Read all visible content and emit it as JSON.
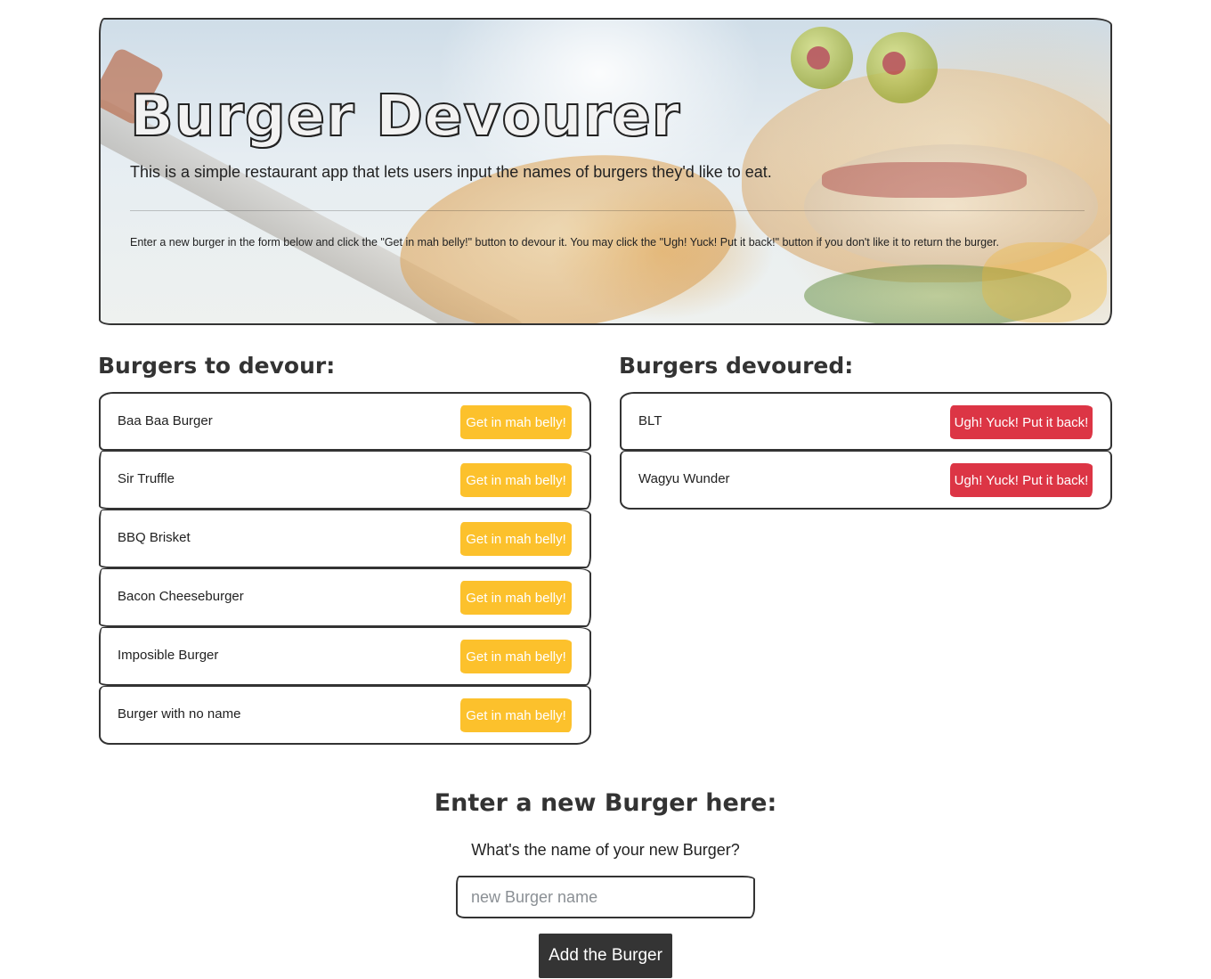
{
  "hero": {
    "title": "Burger Devourer",
    "lead": "This is a simple restaurant app that lets users input the names of burgers they'd like to eat.",
    "instructions": "Enter a new burger in the form below and click the \"Get in mah belly!\" button to devour it. You may click the \"Ugh! Yuck! Put it back!\" button if you don't like it to return the burger."
  },
  "to_devour": {
    "heading": "Burgers to devour:",
    "button_label": "Get in mah belly!",
    "items": [
      {
        "name": "Baa Baa Burger"
      },
      {
        "name": "Sir Truffle"
      },
      {
        "name": "BBQ Brisket"
      },
      {
        "name": "Bacon Cheeseburger"
      },
      {
        "name": "Imposible Burger"
      },
      {
        "name": "Burger with no name"
      }
    ]
  },
  "devoured": {
    "heading": "Burgers devoured:",
    "button_label": "Ugh! Yuck! Put it back!",
    "items": [
      {
        "name": "BLT"
      },
      {
        "name": "Wagyu Wunder"
      }
    ]
  },
  "form": {
    "heading": "Enter a new Burger here:",
    "label": "What's the name of your new Burger?",
    "placeholder": "new Burger name",
    "value": "",
    "submit_label": "Add the Burger"
  },
  "colors": {
    "devour_button": "#fcc12c",
    "return_button": "#dc3545",
    "submit_button": "#343434"
  }
}
